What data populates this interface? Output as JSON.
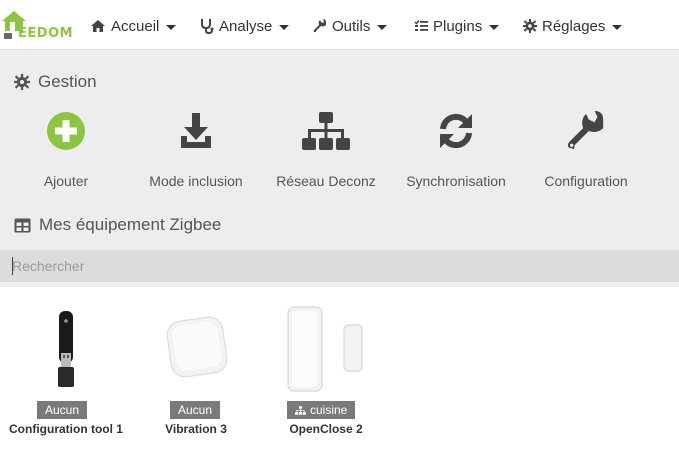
{
  "app": {
    "logo_text": "EEDOM"
  },
  "nav": {
    "items": [
      {
        "label": "Accueil",
        "icon": "home-icon"
      },
      {
        "label": "Analyse",
        "icon": "stethoscope-icon"
      },
      {
        "label": "Outils",
        "icon": "wrench-icon"
      },
      {
        "label": "Plugins",
        "icon": "tasks-icon"
      },
      {
        "label": "Réglages",
        "icon": "cog-icon"
      }
    ]
  },
  "gestion": {
    "title": "Gestion",
    "actions": [
      {
        "label": "Ajouter",
        "icon": "plus-circle-icon",
        "color": "#8cc63f"
      },
      {
        "label": "Mode inclusion",
        "icon": "download-icon",
        "color": "#444444"
      },
      {
        "label": "Réseau Deconz",
        "icon": "sitemap-icon",
        "color": "#444444"
      },
      {
        "label": "Synchronisation",
        "icon": "sync-icon",
        "color": "#444444"
      },
      {
        "label": "Configuration",
        "icon": "wrench-icon",
        "color": "#444444"
      }
    ]
  },
  "equipments": {
    "title": "Mes équipement Zigbee",
    "search_placeholder": "Rechercher",
    "items": [
      {
        "name": "Configuration tool 1",
        "object": "Aucun",
        "image": "usb-dongle"
      },
      {
        "name": "Vibration 3",
        "object": "Aucun",
        "image": "vibration-sensor"
      },
      {
        "name": "OpenClose 2",
        "object": "cuisine",
        "object_icon": "sitemap-icon",
        "image": "door-sensor"
      }
    ]
  },
  "colors": {
    "accent": "#8cc63f",
    "badge": "#7a7a7a",
    "search_bg": "#dcdcdc"
  }
}
